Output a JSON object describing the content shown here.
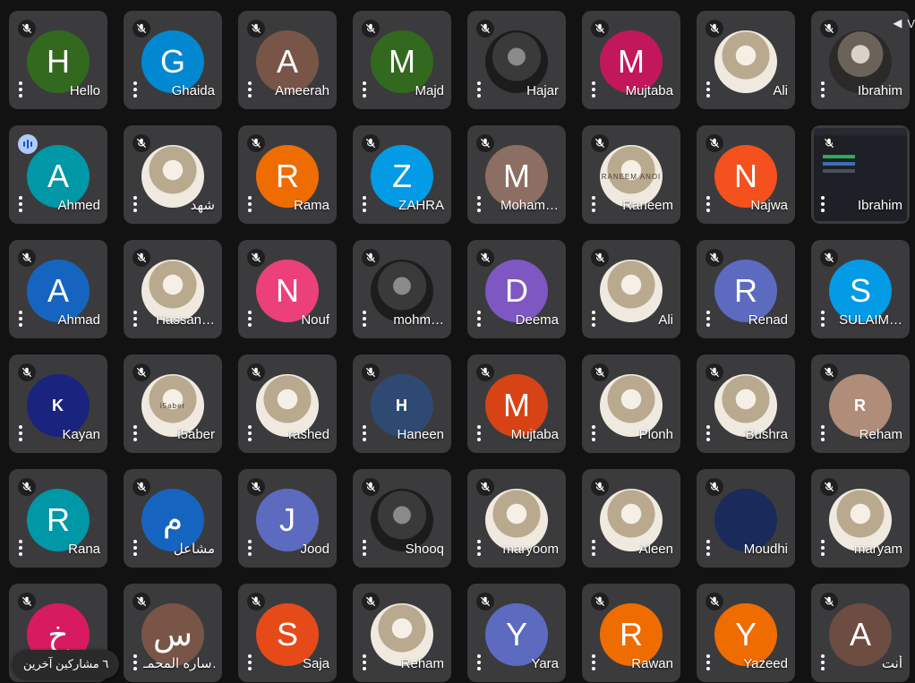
{
  "others_label": "٦ مشاركين آخرين",
  "corner_text": "V",
  "participants": [
    {
      "name": "Hello",
      "initial": "H",
      "color": "#33691e",
      "mic": "muted"
    },
    {
      "name": "Ghaida",
      "initial": "G",
      "color": "#0288d1",
      "mic": "muted"
    },
    {
      "name": "Ameerah",
      "initial": "A",
      "color": "#795548",
      "mic": "muted"
    },
    {
      "name": "Majd",
      "initial": "M",
      "color": "#33691e",
      "mic": "muted"
    },
    {
      "name": "Hajar",
      "initial": "",
      "color": "photo-dark",
      "mic": "muted"
    },
    {
      "name": "Mujtaba",
      "initial": "M",
      "color": "#c2185b",
      "mic": "muted"
    },
    {
      "name": "Ali",
      "initial": "",
      "color": "photo-light",
      "mic": "muted"
    },
    {
      "name": "Ibrahim",
      "initial": "",
      "color": "photo",
      "mic": "muted"
    },
    {
      "name": "Ahmed",
      "initial": "A",
      "color": "#0097a7",
      "mic": "speaking"
    },
    {
      "name": "شهد",
      "initial": "",
      "color": "photo-light",
      "mic": "muted"
    },
    {
      "name": "Rama",
      "initial": "R",
      "color": "#ef6c00",
      "mic": "muted"
    },
    {
      "name": "ZAHRA",
      "initial": "Z",
      "color": "#039be5",
      "mic": "muted"
    },
    {
      "name": "Moham…",
      "initial": "M",
      "color": "#8d6e63",
      "mic": "muted"
    },
    {
      "name": "Raneem",
      "initial": "",
      "color": "photo-light",
      "mic": "muted",
      "photo_text": "RANEEM ANOI"
    },
    {
      "name": "Najwa",
      "initial": "N",
      "color": "#f4511e",
      "mic": "muted"
    },
    {
      "name": "Ibrahim",
      "initial": "",
      "color": "photo-screen",
      "mic": "muted"
    },
    {
      "name": "Ahmad",
      "initial": "A",
      "color": "#1565c0",
      "mic": "muted"
    },
    {
      "name": "Hassan…",
      "initial": "",
      "color": "photo-light",
      "mic": "muted"
    },
    {
      "name": "Nouf",
      "initial": "N",
      "color": "#ec407a",
      "mic": "muted"
    },
    {
      "name": "mohm…",
      "initial": "",
      "color": "photo-dark",
      "mic": "muted"
    },
    {
      "name": "Deema",
      "initial": "D",
      "color": "#7e57c2",
      "mic": "muted"
    },
    {
      "name": "Ali",
      "initial": "",
      "color": "photo-light",
      "mic": "muted"
    },
    {
      "name": "Renad",
      "initial": "R",
      "color": "#5c6bc0",
      "mic": "muted"
    },
    {
      "name": "SULAIM…",
      "initial": "S",
      "color": "#039be5",
      "mic": "muted"
    },
    {
      "name": "Kayan",
      "initial": "",
      "color": "#1a237e",
      "mic": "muted",
      "photo_text": "K"
    },
    {
      "name": "i5aber",
      "initial": "",
      "color": "photo-light",
      "mic": "muted",
      "photo_text": "i5aber"
    },
    {
      "name": "rashed",
      "initial": "",
      "color": "photo-light",
      "mic": "muted"
    },
    {
      "name": "Haneen",
      "initial": "",
      "color": "#2e4a73",
      "mic": "muted",
      "photo_text": "H"
    },
    {
      "name": "Mujtaba",
      "initial": "M",
      "color": "#d84315",
      "mic": "muted"
    },
    {
      "name": "Plonh",
      "initial": "",
      "color": "photo-light",
      "mic": "muted"
    },
    {
      "name": "Bushra",
      "initial": "",
      "color": "photo-light",
      "mic": "muted"
    },
    {
      "name": "Reham",
      "initial": "",
      "color": "#b08d79",
      "mic": "muted",
      "photo_text": "R"
    },
    {
      "name": "Rana",
      "initial": "R",
      "color": "#0097a7",
      "mic": "muted"
    },
    {
      "name": "مشاعل",
      "initial": "م",
      "color": "#1565c0",
      "mic": "muted"
    },
    {
      "name": "Jood",
      "initial": "J",
      "color": "#5c6bc0",
      "mic": "muted"
    },
    {
      "name": "Shooq",
      "initial": "",
      "color": "photo-dark",
      "mic": "muted"
    },
    {
      "name": "maryoom",
      "initial": "",
      "color": "photo-light",
      "mic": "muted"
    },
    {
      "name": "Aleen",
      "initial": "",
      "color": "photo-light",
      "mic": "muted"
    },
    {
      "name": "Moudhi",
      "initial": "",
      "color": "#1a2a5a",
      "mic": "muted"
    },
    {
      "name": "maryam",
      "initial": "",
      "color": "photo-light",
      "mic": "muted"
    },
    {
      "name": "",
      "initial": "خ",
      "color": "#d81b60",
      "mic": "muted"
    },
    {
      "name": "ساره المحمـ…",
      "initial": "س",
      "color": "#795548",
      "mic": "muted"
    },
    {
      "name": "Saja",
      "initial": "S",
      "color": "#e64a19",
      "mic": "muted"
    },
    {
      "name": "Reham",
      "initial": "",
      "color": "photo-light",
      "mic": "muted"
    },
    {
      "name": "Yara",
      "initial": "Y",
      "color": "#5c6bc0",
      "mic": "muted"
    },
    {
      "name": "Rawan",
      "initial": "R",
      "color": "#ef6c00",
      "mic": "muted"
    },
    {
      "name": "Yazeed",
      "initial": "Y",
      "color": "#ef6c00",
      "mic": "muted"
    },
    {
      "name": "أنت",
      "initial": "A",
      "color": "#6d4c41",
      "mic": "muted"
    }
  ]
}
